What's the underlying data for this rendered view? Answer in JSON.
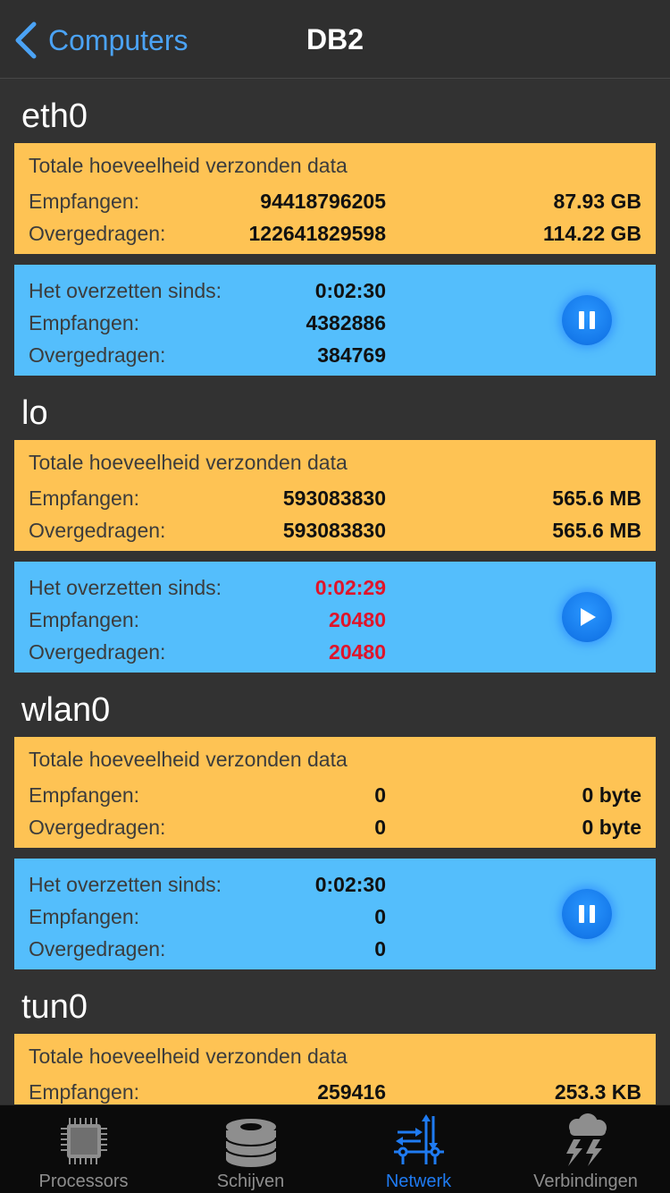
{
  "nav": {
    "back_label": "Computers",
    "title": "DB2"
  },
  "labels": {
    "total_heading": "Totale hoeveelheid verzonden data",
    "received": "Empfangen:",
    "transferred": "Overgedragen:",
    "since": "Het overzetten sinds:"
  },
  "interfaces": [
    {
      "name": "eth0",
      "total": {
        "received": "94418796205",
        "received_size": "87.93 GB",
        "transferred": "122641829598",
        "transferred_size": "114.22 GB"
      },
      "session": {
        "since": "0:02:30",
        "received": "4382886",
        "transferred": "384769",
        "state": "running",
        "control_icon": "pause-icon",
        "highlight": false
      }
    },
    {
      "name": "lo",
      "total": {
        "received": "593083830",
        "received_size": "565.6 MB",
        "transferred": "593083830",
        "transferred_size": "565.6 MB"
      },
      "session": {
        "since": "0:02:29",
        "received": "20480",
        "transferred": "20480",
        "state": "paused",
        "control_icon": "play-icon",
        "highlight": true
      }
    },
    {
      "name": "wlan0",
      "total": {
        "received": "0",
        "received_size": "0 byte",
        "transferred": "0",
        "transferred_size": "0 byte"
      },
      "session": {
        "since": "0:02:30",
        "received": "0",
        "transferred": "0",
        "state": "running",
        "control_icon": "pause-icon",
        "highlight": false
      }
    },
    {
      "name": "tun0",
      "total": {
        "received": "259416",
        "received_size": "253.3 KB"
      }
    }
  ],
  "colors": {
    "accent": "#1f7bf2",
    "total_card": "#fec354",
    "session_card": "#54befc",
    "warning_text": "#e0142a"
  },
  "tabs": [
    {
      "label": "Processors",
      "icon": "chip-icon",
      "active": false
    },
    {
      "label": "Schijven",
      "icon": "disk-stack-icon",
      "active": false
    },
    {
      "label": "Netwerk",
      "icon": "network-icon",
      "active": true
    },
    {
      "label": "Verbindingen",
      "icon": "storm-cloud-icon",
      "active": false
    }
  ]
}
